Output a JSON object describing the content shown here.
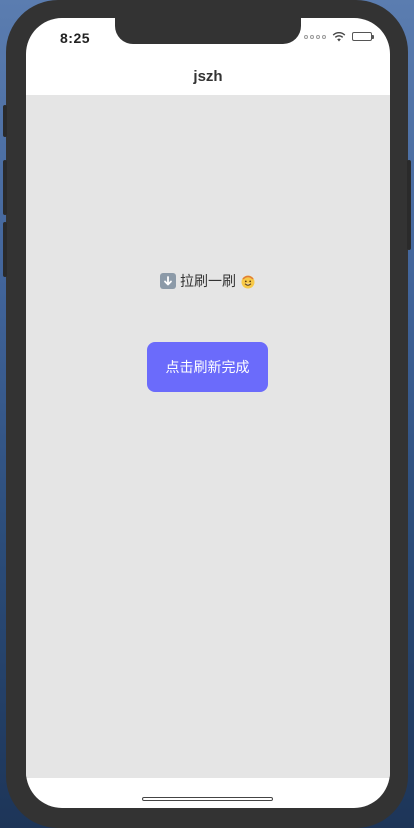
{
  "status_bar": {
    "time": "8:25",
    "signal_icon": "signal-dots-icon",
    "wifi_icon": "wifi-icon",
    "battery_icon": "battery-icon"
  },
  "nav": {
    "title": "jszh"
  },
  "content": {
    "pull_hint_text": "拉刷一刷",
    "pull_hint_leading_icon": "down-arrow-icon",
    "pull_hint_trailing_icon": "smile-emoji-icon",
    "refresh_button_label": "点击刷新完成"
  },
  "colors": {
    "content_background": "#e5e5e5",
    "button_background": "#6b6bfb",
    "button_text": "#ffffff"
  }
}
